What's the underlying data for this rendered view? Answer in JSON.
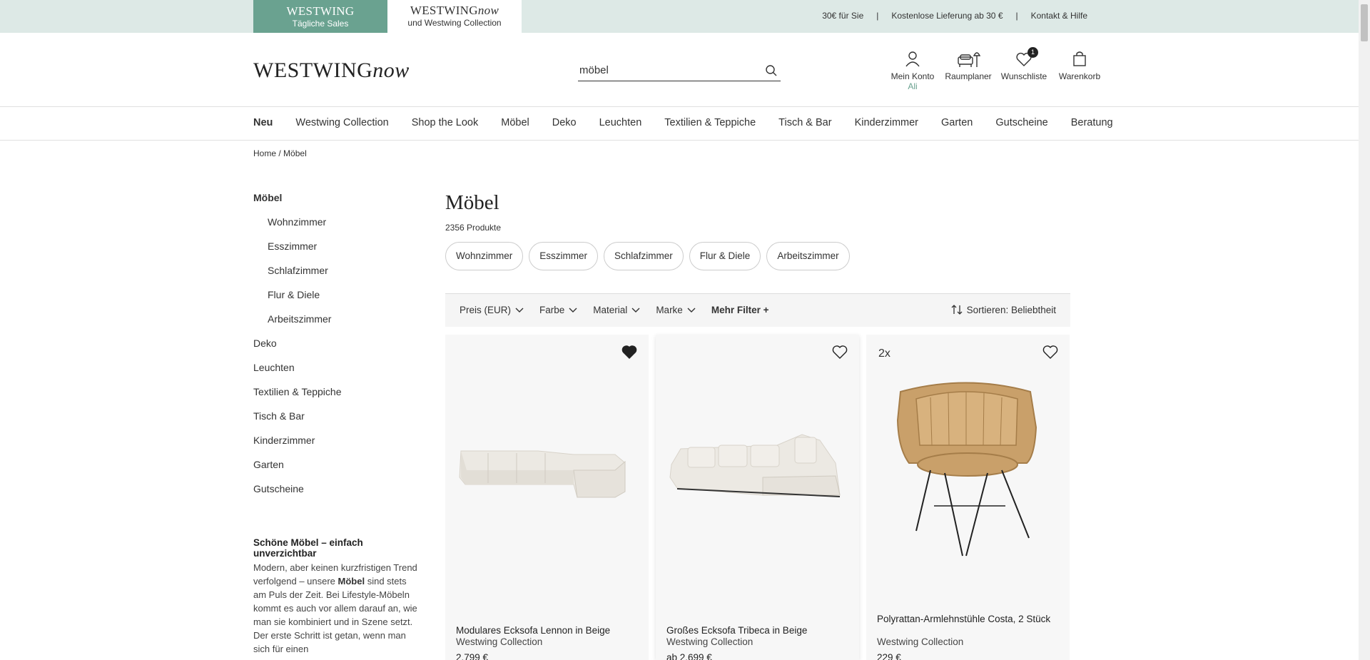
{
  "topbar": {
    "sales_tab": {
      "brand": "WESTWING",
      "sub": "Tägliche Sales"
    },
    "now_tab": {
      "brand": "WESTWING",
      "brand_italic": "now",
      "sub": "und Westwing Collection"
    },
    "links": [
      "30€ für Sie",
      "Kostenlose Lieferung ab 30 €",
      "Kontakt & Hilfe"
    ],
    "separator": "|",
    "colors": {
      "bar_bg": "#dde9e6",
      "sales_bg": "#6aa290"
    }
  },
  "header": {
    "logo": {
      "text": "WESTWING",
      "italic": "now"
    },
    "search": {
      "value": "möbel",
      "icon": "search-icon"
    },
    "icons": [
      {
        "label": "Mein Konto",
        "sub": "Ali",
        "icon": "user-icon"
      },
      {
        "label": "Raumplaner",
        "icon": "room-planner-icon"
      },
      {
        "label": "Wunschliste",
        "badge": "1",
        "icon": "heart-icon"
      },
      {
        "label": "Warenkorb",
        "icon": "bag-icon"
      }
    ]
  },
  "nav": {
    "items": [
      "Neu",
      "Westwing Collection",
      "Shop the Look",
      "Möbel",
      "Deko",
      "Leuchten",
      "Textilien & Teppiche",
      "Tisch & Bar",
      "Kinderzimmer",
      "Garten",
      "Gutscheine",
      "Beratung"
    ]
  },
  "breadcrumb": {
    "home": "Home",
    "sep": "/",
    "current": "Möbel"
  },
  "sidebar": {
    "items": [
      {
        "label": "Möbel",
        "level": 0
      },
      {
        "label": "Wohnzimmer",
        "level": 1
      },
      {
        "label": "Esszimmer",
        "level": 1
      },
      {
        "label": "Schlafzimmer",
        "level": 1
      },
      {
        "label": "Flur & Diele",
        "level": 1
      },
      {
        "label": "Arbeitszimmer",
        "level": 1
      },
      {
        "label": "Deko",
        "level": 0
      },
      {
        "label": "Leuchten",
        "level": 0
      },
      {
        "label": "Textilien & Teppiche",
        "level": 0
      },
      {
        "label": "Tisch & Bar",
        "level": 0
      },
      {
        "label": "Kinderzimmer",
        "level": 0
      },
      {
        "label": "Garten",
        "level": 0
      },
      {
        "label": "Gutscheine",
        "level": 0
      }
    ],
    "seo_title": "Schöne Möbel – einfach unverzichtbar",
    "seo_text_pre": "Modern, aber keinen kurzfristigen Trend verfolgend – unsere ",
    "seo_text_bold": "Möbel",
    "seo_text_post": " sind stets am Puls der Zeit. Bei Lifestyle-Möbeln kommt es auch vor allem darauf an, wie man sie kombiniert und in Szene setzt. Der erste Schritt ist getan, wenn man sich für einen"
  },
  "main": {
    "title": "Möbel",
    "count": "2356 Produkte",
    "chips": [
      "Wohnzimmer",
      "Esszimmer",
      "Schlafzimmer",
      "Flur & Diele",
      "Arbeitszimmer"
    ],
    "filters": [
      "Preis (EUR)",
      "Farbe",
      "Material",
      "Marke"
    ],
    "more_filter": "Mehr Filter +",
    "sort": "Sortieren: Beliebtheit",
    "products": [
      {
        "name": "Modulares Ecksofa Lennon in Beige",
        "brand": "Westwing Collection",
        "price": "2.799 €",
        "wishlisted": true
      },
      {
        "name": "Großes Ecksofa Tribeca in Beige",
        "brand": "Westwing Collection",
        "price": "ab 2.699 €",
        "wishlisted": false
      },
      {
        "name": "Polyrattan-Armlehnstühle Costa, 2 Stück",
        "brand": "Westwing Collection",
        "price": "229 €",
        "qty": "2x",
        "wishlisted": false
      }
    ]
  }
}
